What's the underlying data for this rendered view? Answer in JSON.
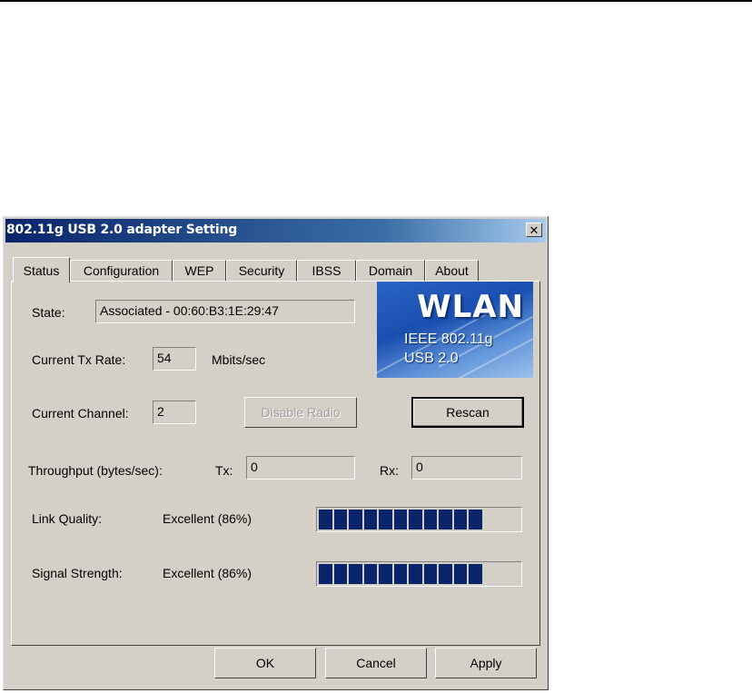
{
  "window": {
    "title": "802.11g USB 2.0 adapter Setting",
    "close_glyph": "✕"
  },
  "tabs": [
    {
      "label": "Status",
      "active": true
    },
    {
      "label": "Configuration"
    },
    {
      "label": "WEP"
    },
    {
      "label": "Security"
    },
    {
      "label": "IBSS"
    },
    {
      "label": "Domain"
    },
    {
      "label": "About"
    }
  ],
  "status": {
    "state_label": "State:",
    "state_value": "Associated - 00:60:B3:1E:29:47",
    "tx_rate_label": "Current Tx Rate:",
    "tx_rate_value": "54",
    "tx_rate_unit": "Mbits/sec",
    "channel_label": "Current Channel:",
    "channel_value": "2",
    "disable_radio_label": "Disable Radio",
    "rescan_label": "Rescan",
    "throughput_label": "Throughput (bytes/sec):",
    "tx_label": "Tx:",
    "tx_value": "0",
    "rx_label": "Rx:",
    "rx_value": "0",
    "link_quality_label": "Link Quality:",
    "link_quality_value": "Excellent (86%)",
    "link_quality_percent": 86,
    "signal_strength_label": "Signal Strength:",
    "signal_strength_value": "Excellent (86%)",
    "signal_strength_percent": 86
  },
  "logo": {
    "title": "WLAN",
    "line1": "IEEE 802.11g",
    "line2": "USB 2.0"
  },
  "footer": {
    "ok_label": "OK",
    "cancel_label": "Cancel",
    "apply_label": "Apply"
  },
  "colors": {
    "dialog_bg": "#d4d0c8",
    "titlebar": "#0a246a",
    "meter_fill": "#0a246a",
    "logo_blue": "#2b64c3"
  }
}
